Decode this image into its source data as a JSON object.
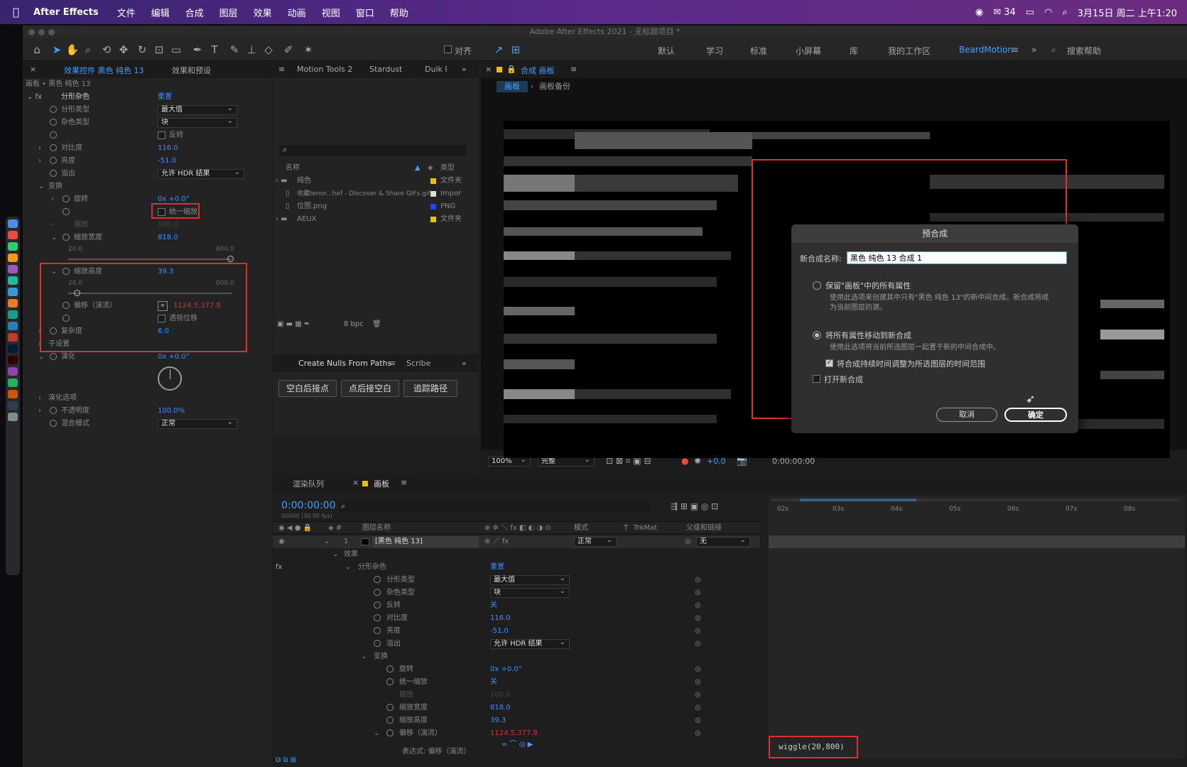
{
  "menubar": {
    "app": "After Effects",
    "items": [
      "文件",
      "编辑",
      "合成",
      "图层",
      "效果",
      "动画",
      "视图",
      "窗口",
      "帮助"
    ],
    "wechat_count": "34",
    "datetime": "3月15日 周二 上午1:20"
  },
  "window": {
    "title": "Adobe After Effects 2021 - 无标题项目 *"
  },
  "toolbar": {
    "snap": "对齐",
    "workspaces": [
      "默认",
      "学习",
      "标准",
      "小屏幕",
      "库",
      "我的工作区",
      "BeardMotion"
    ],
    "search": "搜索帮助"
  },
  "effects": {
    "tab1": "效果控件 黑色 纯色 13",
    "tab2": "效果和预设",
    "layer": "画板 • 黑色 纯色 13",
    "effect": "分形杂色",
    "reset": "重置",
    "rows": {
      "fractal_type": "分形类型",
      "fractal_type_val": "最大值",
      "noise_type": "杂色类型",
      "noise_type_val": "块",
      "invert": "反转",
      "contrast": "对比度",
      "contrast_val": "116.0",
      "brightness": "亮度",
      "brightness_val": "-51.0",
      "overflow": "溢出",
      "overflow_val": "允许 HDR 结果",
      "transform": "变换",
      "rotation": "旋转",
      "rotation_val": "0x +0.0°",
      "uniform": "统一缩放",
      "scale": "缩放",
      "scale_val": "100.0",
      "scale_w": "缩放宽度",
      "scale_w_val": "818.0",
      "scale_h": "缩放高度",
      "scale_h_val": "39.3",
      "min": "20.0",
      "max": "600.0",
      "offset": "偏移（湍流）",
      "offset_val": "1124.5,377.8",
      "perspective": "透视位移",
      "complexity": "复杂度",
      "complexity_val": "6.0",
      "sub": "子设置",
      "evolution": "演化",
      "evolution_val": "0x +0.0°",
      "evo_opts": "演化选项",
      "opacity": "不透明度",
      "opacity_val": "100.0%",
      "blend": "混合模式",
      "blend_val": "正常"
    }
  },
  "project": {
    "tabs": [
      "Motion Tools 2",
      "Stardust",
      "Duik I"
    ],
    "col_name": "名称",
    "col_type": "类型",
    "items": [
      {
        "name": "纯色",
        "type": "文件夹"
      },
      {
        "name": "收藏tenor...hef - Discover & Share GIFs.gif",
        "type": "Impor"
      },
      {
        "name": "位图.png",
        "type": "PNG"
      },
      {
        "name": "AEUX",
        "type": "文件夹"
      }
    ],
    "bpc": "8 bpc"
  },
  "nulls": {
    "tab": "Create Nulls From Paths",
    "tab2": "Scribe",
    "btn1": "空白后接点",
    "btn2": "点后接空白",
    "btn3": "追踪路径"
  },
  "comp": {
    "tab": "合成 画板",
    "crumb1": "画板",
    "crumb2": "画板备份",
    "zoom": "100%",
    "quality": "完整",
    "exposure": "+0.0",
    "time": "0:00:00:00"
  },
  "dialog": {
    "title": "预合成",
    "name_label": "新合成名称:",
    "name_value": "黑色 纯色 13 合成 1",
    "opt1": "保留\"画板\"中的所有属性",
    "opt1_desc1": "使用此选项来创建其中只有\"黑色 纯色 13\"的新中间合成。新合成将成",
    "opt1_desc2": "为当前图层的源。",
    "opt2": "将所有属性移动到新合成",
    "opt2_desc": "使用此选项将当前所选图层一起置于新的中间合成中。",
    "chk1": "将合成持续时间调整为所选图层的时间范围",
    "chk2": "打开新合成",
    "cancel": "取消",
    "ok": "确定"
  },
  "timeline": {
    "tab1": "渲染队列",
    "tab2": "画板",
    "time": "0:00:00:00",
    "fps": "00000 (30.00 fps)",
    "col_layer": "图层名称",
    "col_mode": "模式",
    "col_t": "T",
    "col_trk": "TrkMat",
    "col_parent": "父级和链接",
    "layer_num": "1",
    "layer_name": "[黑色 纯色 13]",
    "mode": "正常",
    "parent": "无",
    "effects": "效果",
    "expr_label": "表达式: 偏移（湍流）",
    "expression": "wiggle(20,800)",
    "off": "关",
    "ticks": [
      "02s",
      "03s",
      "04s",
      "05s",
      "06s",
      "07s",
      "08s"
    ]
  }
}
